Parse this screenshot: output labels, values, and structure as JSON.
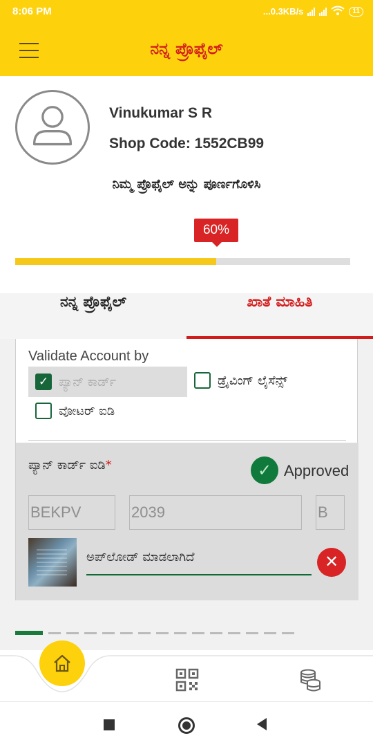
{
  "status_bar": {
    "time": "8:06 PM",
    "net_speed": "...0.3KB/s",
    "net_type_1": "Vo LTE",
    "net_type_2": "Vo LTE",
    "battery": "11"
  },
  "app_bar": {
    "title": "ನನ್ನ ಪ್ರೊಫೈಲ್",
    "menu_icon": "hamburger-menu-icon"
  },
  "profile": {
    "avatar_icon": "user-avatar-icon",
    "name": "Vinukumar S R",
    "shop_code": "Shop Code: 1552CB99",
    "complete_prompt": "ನಿಮ್ಮ ಪ್ರೊಫೈಲ್ ಅನ್ನು ಪೂರ್ಣಗೊಳಿಸಿ",
    "progress_label": "60%",
    "progress_fraction": 0.6
  },
  "tabs": [
    {
      "label": "ನನ್ನ ಪ್ರೊಫೈಲ್",
      "active": false
    },
    {
      "label": "ಖಾತೆ ಮಾಹಿತಿ",
      "active": true
    }
  ],
  "validate": {
    "label": "Validate Account by",
    "options": [
      {
        "label": "ಪ್ಯಾನ್ ಕಾರ್ಡ್",
        "checked": true
      },
      {
        "label": "ಡ್ರೈವಿಂಗ್ ಲೈಸೆನ್ಸ್",
        "checked": false
      },
      {
        "label": "ವೋಟರ್ ಐಡಿ",
        "checked": false
      }
    ]
  },
  "pan": {
    "label": "ಪ್ಯಾನ್ ಕಾರ್ಡ್ ಐಡಿ",
    "required_mark": "*",
    "status": "Approved",
    "fields": [
      "BEKPV",
      "2039",
      "B"
    ],
    "upload_status": "ಅಪ್‌ಲೋಡ್ ಮಾಡಲಾಗಿದೆ",
    "remove_symbol": "✕"
  },
  "bottom_nav": {
    "items": [
      "home-icon",
      "qr-code-icon",
      "coins-icon"
    ]
  },
  "colors": {
    "brand_yellow": "#fdd10c",
    "accent_red": "#d21c1c",
    "approved_green": "#0f7a3c"
  }
}
